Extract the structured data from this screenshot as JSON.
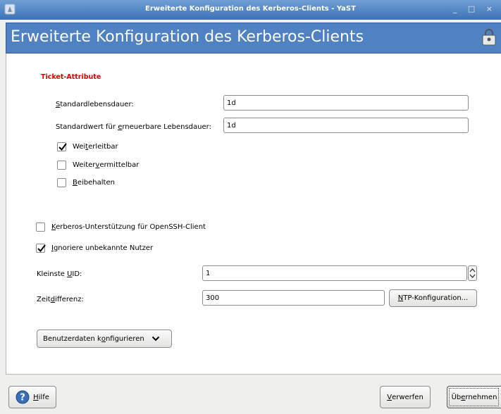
{
  "window": {
    "title": "Erweiterte Konfiguration des Kerberos-Clients - YaST",
    "controls": "_ □ ×"
  },
  "header": {
    "title": "Erweiterte Konfiguration des Kerberos-Clients"
  },
  "ticket": {
    "section_title": "Ticket-Attribute",
    "default_lifetime_pre": "",
    "default_lifetime_u": "S",
    "default_lifetime_post": "tandardlebensdauer:",
    "default_lifetime_value": "1d",
    "renewable_pre": "Standardwert für ",
    "renewable_u": "e",
    "renewable_post": "rneuerbare Lebensdauer:",
    "renewable_value": "1d",
    "forwardable_pre": "Wei",
    "forwardable_u": "t",
    "forwardable_post": "erleitbar",
    "forwardable_checked": true,
    "proxiable_pre": "Weiter",
    "proxiable_u": "v",
    "proxiable_post": "ermittelbar",
    "proxiable_checked": false,
    "retain_pre": "",
    "retain_u": "B",
    "retain_post": "eibehalten",
    "retain_checked": false
  },
  "openssh": {
    "pre": "",
    "u": "K",
    "post": "erberos-Unterstützung für OpenSSH-Client",
    "checked": false
  },
  "ignore_unknown": {
    "pre": "",
    "u": "I",
    "post": "gnoriere unbekannte Nutzer",
    "checked": true
  },
  "min_uid": {
    "pre": "Kleinste ",
    "u": "U",
    "post": "ID:",
    "value": "1"
  },
  "clockskew": {
    "pre": "Zeit",
    "u": "d",
    "post": "ifferenz:",
    "value": "300"
  },
  "ntp_button": {
    "pre": "",
    "u": "N",
    "post": "TP-Konfiguration..."
  },
  "user_data_button": {
    "pre": "Benutzerdaten k",
    "u": "o",
    "post": "nfigurieren"
  },
  "footer": {
    "help_pre": "",
    "help_u": "H",
    "help_post": "ilfe",
    "discard_pre": "",
    "discard_u": "V",
    "discard_post": "erwerfen",
    "apply_pre": "Üb",
    "apply_u": "e",
    "apply_post": "rnehmen"
  },
  "colors": {
    "header_bg": "#4f81c3",
    "title_bar": "#3d72b4",
    "section_title": "#e00000"
  }
}
